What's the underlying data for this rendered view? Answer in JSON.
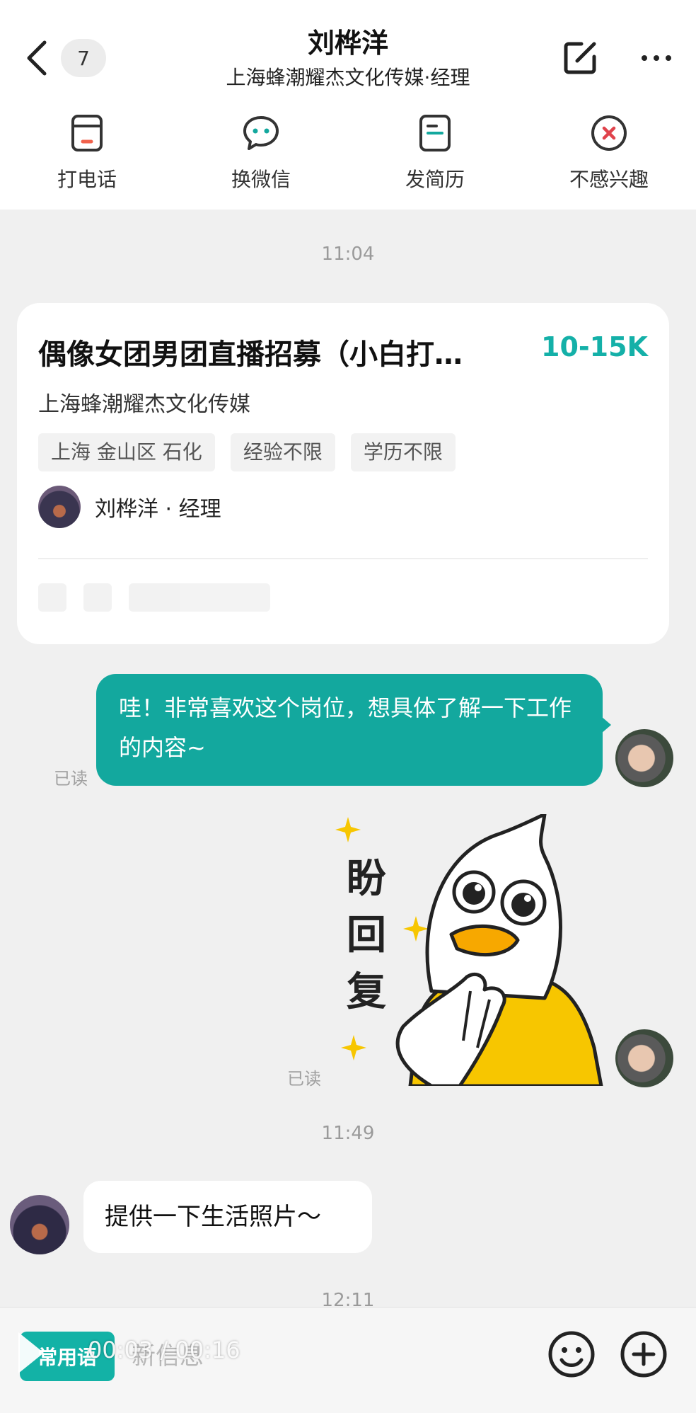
{
  "header": {
    "title": "刘桦洋",
    "subtitle": "上海蜂潮耀杰文化传媒·经理",
    "unread_count": "7"
  },
  "actions": [
    {
      "label": "打电话",
      "icon": "phone-icon"
    },
    {
      "label": "换微信",
      "icon": "wechat-icon"
    },
    {
      "label": "发简历",
      "icon": "resume-icon"
    },
    {
      "label": "不感兴趣",
      "icon": "not-interested-icon"
    }
  ],
  "chat": {
    "timestamps": [
      "11:04",
      "11:49",
      "12:11"
    ],
    "job_card": {
      "title": "偶像女团男团直播招募（小白打…",
      "salary": "10-15K",
      "company": "上海蜂潮耀杰文化传媒",
      "tags": [
        "上海 金山区 石化",
        "经验不限",
        "学历不限"
      ],
      "recruiter": "刘桦洋 · 经理"
    },
    "outgoing_message": "哇！非常喜欢这个岗位，想具体了解一下工作的内容~",
    "read_label": "已读",
    "sticker_text": [
      "盼",
      "回",
      "复"
    ],
    "incoming_message": "提供一下生活照片～"
  },
  "bottom_bar": {
    "quick_phrases_label": "常用语",
    "input_placeholder": "新信息"
  },
  "video": {
    "time": "00:03 / 00:16"
  },
  "colors": {
    "accent": "#13a89e",
    "salary": "#14b0a8",
    "danger": "#e0434c",
    "sticker_yellow": "#f7c600"
  }
}
